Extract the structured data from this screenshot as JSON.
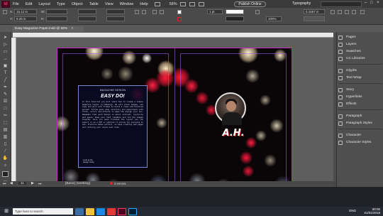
{
  "app": {
    "logo": "Id",
    "menu": [
      "File",
      "Edit",
      "Layout",
      "Type",
      "Object",
      "Table",
      "View",
      "Window",
      "Help"
    ],
    "zoom": "58%",
    "publish_label": "Publish Online",
    "workspace_label": "Typography"
  },
  "control_bar": {
    "x_label": "X:",
    "x_value": "15.12 in",
    "y_label": "Y:",
    "y_value": "9.25 in",
    "w_label": "W:",
    "h_label": "H:",
    "stroke_weight": "1 pt",
    "size_value": "0.1667 in",
    "zoom_pct": "100%"
  },
  "document": {
    "tab_title": "Easy Magazine Paper.indd @ 58%",
    "close_glyph": "×"
  },
  "textbox": {
    "header": "MAGAZINE DESIGN",
    "title": "EASY DO!",
    "body": "In this tutorial you will learn how to create a simple magazine layout in InDesign. We will place images, set type and work with frames to build a clean and balanced spread. Follow each step carefully and experiment with fonts, colors and effects to make the design your own. Remember that good design is about contrast, hierarchy and space. Keep your text readable and let the images breathe. Once you have finished the layout you can export it as a PDF or publish it online for everyone to see. Practice makes perfect, so keep creating new pages and refining your style over time.",
    "footer_1": "Look at the",
    "footer_2": "design today"
  },
  "initials": "A.H.",
  "panels": [
    {
      "label": "Pages",
      "icon": "pages-icon"
    },
    {
      "label": "Layers",
      "icon": "layers-icon"
    },
    {
      "label": "Swatches",
      "icon": "swatches-icon"
    },
    {
      "label": "CC Libraries",
      "icon": "cc-libraries-icon"
    },
    {
      "label": "Glyphs",
      "icon": "glyphs-icon"
    },
    {
      "label": "Text Wrap",
      "icon": "text-wrap-icon"
    },
    {
      "label": "Story",
      "icon": "story-icon"
    },
    {
      "label": "Hyperlinks",
      "icon": "hyperlinks-icon"
    },
    {
      "label": "Effects",
      "icon": "effects-icon"
    },
    {
      "label": "Paragraph",
      "icon": "paragraph-icon"
    },
    {
      "label": "Paragraph Styles",
      "icon": "paragraph-styles-icon"
    },
    {
      "label": "Character",
      "icon": "character-icon"
    },
    {
      "label": "Character Styles",
      "icon": "character-styles-icon"
    }
  ],
  "status": {
    "page": "11",
    "style": "[Basic] (working)",
    "errors": "2 errors"
  },
  "taskbar": {
    "search_placeholder": "Type here to search",
    "lang": "ENG",
    "time": "00:00",
    "date": "01/01/2018"
  },
  "colors": {
    "accent": "#c22ac2",
    "error": "#d62b2b",
    "indesign_logo": "#ff3366"
  }
}
